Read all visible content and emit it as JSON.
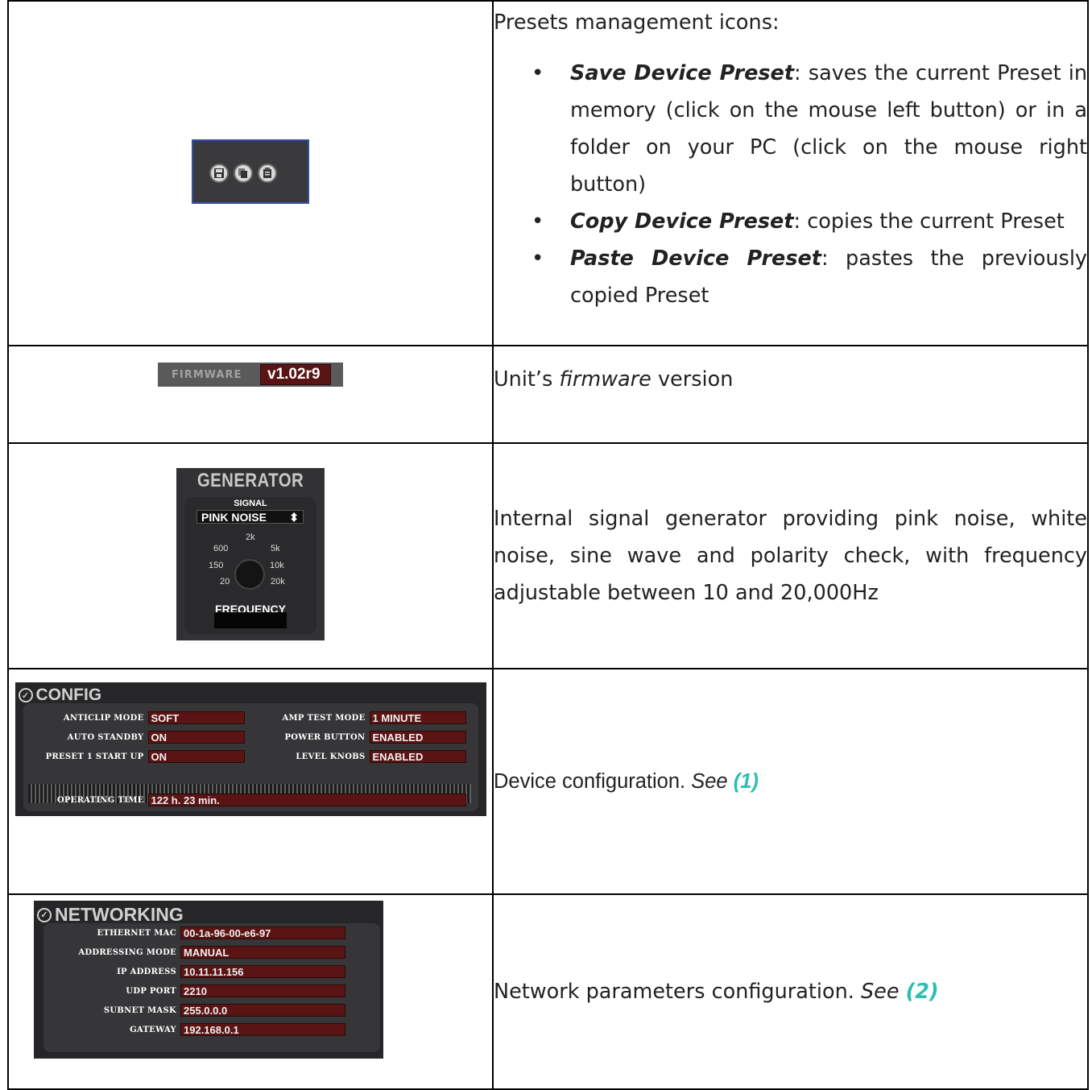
{
  "rows": {
    "presets": {
      "intro_text": "Presets management icons:",
      "icons": [
        "save-icon",
        "copy-icon",
        "paste-icon"
      ],
      "bullets": [
        {
          "term": "Save Device Preset",
          "text": ": saves the current Preset in memory (click on the mouse left button) or in a folder on your PC (click on the mouse right button)"
        },
        {
          "term": "Copy Device Preset",
          "text": ": copies the current Preset"
        },
        {
          "term": "Paste Device Preset",
          "text": ": pastes the previously copied Preset"
        }
      ]
    },
    "firmware": {
      "label": "FIRMWARE",
      "value": "v1.02r9",
      "desc_pre": "Unit’s ",
      "desc_it": "firmware",
      "desc_post": " version"
    },
    "generator": {
      "title": "GENERATOR",
      "signal_label": "SIGNAL",
      "signal_value": "PINK NOISE",
      "ticks": [
        "20",
        "150",
        "600",
        "2k",
        "5k",
        "10k",
        "20k"
      ],
      "frequency_label": "FREQUENCY",
      "desc": "Internal signal generator providing pink noise, white noise, sine wave and polarity check, with frequency adjustable between 10 and 20,000Hz"
    },
    "config": {
      "title": "CONFIG",
      "fields": [
        {
          "label": "ANTICLIP MODE",
          "value": "SOFT"
        },
        {
          "label": "AUTO STANDBY",
          "value": "ON"
        },
        {
          "label": "PRESET 1 START UP",
          "value": "ON"
        },
        {
          "label": "AMP TEST MODE",
          "value": "1 MINUTE"
        },
        {
          "label": "POWER BUTTON",
          "value": "ENABLED"
        },
        {
          "label": "LEVEL KNOBS",
          "value": "ENABLED"
        }
      ],
      "operating_time_label": "OPERATING TIME",
      "operating_time_value": "122 h. 23 min.",
      "desc": "Device configuration. ",
      "desc_see": "See ",
      "desc_ref": "(1)"
    },
    "networking": {
      "title": "NETWORKING",
      "fields": [
        {
          "label": "ETHERNET MAC",
          "value": "00-1a-96-00-e6-97"
        },
        {
          "label": "ADDRESSING MODE",
          "value": "MANUAL"
        },
        {
          "label": "IP ADDRESS",
          "value": "10.11.11.156"
        },
        {
          "label": "UDP PORT",
          "value": "2210"
        },
        {
          "label": "SUBNET MASK",
          "value": "255.0.0.0"
        },
        {
          "label": "GATEWAY",
          "value": "192.168.0.1"
        }
      ],
      "desc": "Network parameters configuration. ",
      "desc_see": "See ",
      "desc_ref": "(2)"
    }
  },
  "colors": {
    "reference": "#2bbfb1",
    "field_bg": "#5a1414",
    "panel_bg": "#262628"
  }
}
